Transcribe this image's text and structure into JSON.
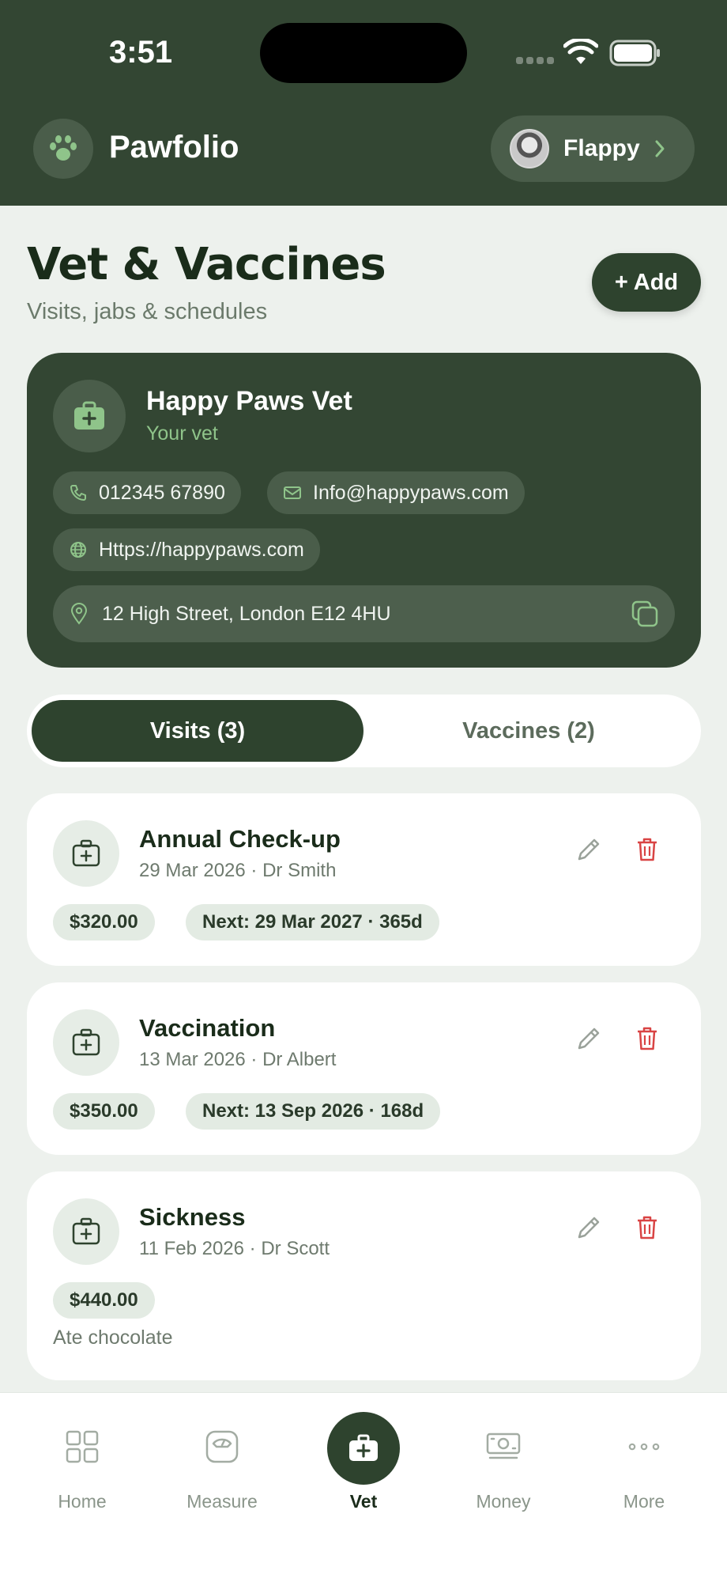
{
  "status_bar": {
    "time": "3:51"
  },
  "header": {
    "app_title": "Pawfolio",
    "pet_name": "Flappy"
  },
  "page": {
    "title": "Vet & Vaccines",
    "subtitle": "Visits, jabs & schedules",
    "add_label": "+ Add"
  },
  "vet": {
    "name": "Happy Paws Vet",
    "role": "Your vet",
    "phone": "012345 67890",
    "email": "Info@happypaws.com",
    "website": "Https://happypaws.com",
    "address": "12 High Street, London E12 4HU"
  },
  "tabs": [
    {
      "label": "Visits (3)",
      "active": true
    },
    {
      "label": "Vaccines (2)",
      "active": false
    }
  ],
  "visits": [
    {
      "title": "Annual Check-up",
      "meta": "29 Mar 2026 · Dr Smith",
      "cost": "$320.00",
      "next": "Next: 29 Mar 2027 · 365d",
      "note": ""
    },
    {
      "title": "Vaccination",
      "meta": "13 Mar 2026 · Dr Albert",
      "cost": "$350.00",
      "next": "Next: 13 Sep 2026 · 168d",
      "note": ""
    },
    {
      "title": "Sickness",
      "meta": "11 Feb 2026 · Dr Scott",
      "cost": "$440.00",
      "next": "",
      "note": "Ate chocolate"
    }
  ],
  "nav": [
    {
      "label": "Home",
      "icon": "grid-icon"
    },
    {
      "label": "Measure",
      "icon": "scale-icon"
    },
    {
      "label": "Vet",
      "icon": "medkit-icon",
      "active": true
    },
    {
      "label": "Money",
      "icon": "cash-icon"
    },
    {
      "label": "More",
      "icon": "more-icon"
    }
  ],
  "colors": {
    "header_bg": "#334633",
    "accent_green": "#8fc48a",
    "danger_red": "#d94444",
    "page_bg": "#edf1ed"
  }
}
